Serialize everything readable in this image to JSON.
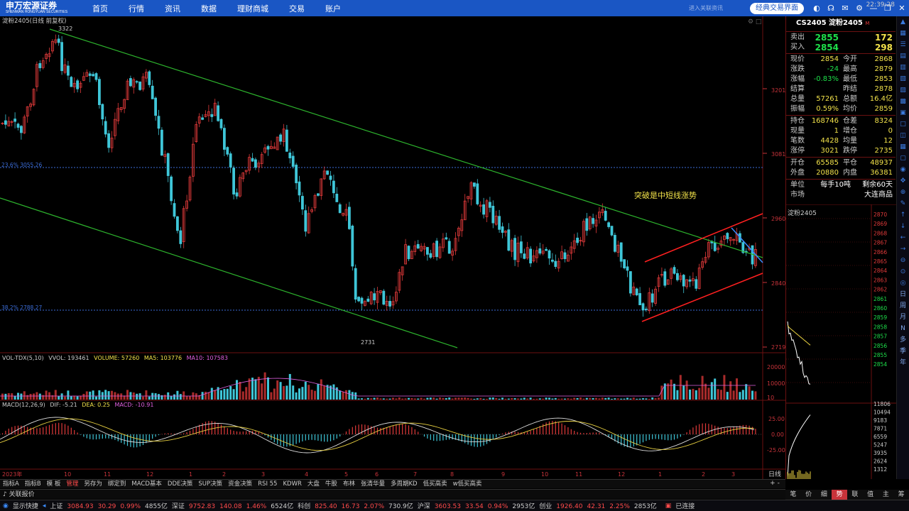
{
  "app": {
    "logo": "申万宏源证券",
    "logo_sub": "SHENWAN HONGYUAN SECURITIES",
    "nav": [
      "首页",
      "行情",
      "资讯",
      "数据",
      "理财商城",
      "交易",
      "账户"
    ],
    "hint": "进入关联资讯",
    "classic_button": "经典交易界面"
  },
  "chart": {
    "title": "淀粉2405(日线 前复权)",
    "high_label": "3322",
    "low_label": "2731",
    "fib1": "23.6% 3055.26",
    "fib2": "38.2% 2788.27",
    "annotation": "突破是中短线涨势",
    "price_axis": [
      "3201",
      "3081",
      "2960",
      "2840",
      "2719"
    ],
    "volume_header": {
      "indicator": "VOL-TDX(5,10)",
      "vvol": "VVOL: 193461",
      "volume": "VOLUME: 57260",
      "ma5": "MA5: 103776",
      "ma10": "MA10: 107583"
    },
    "volume_axis": [
      "20000",
      "10000",
      "10"
    ],
    "macd_header": {
      "indicator": "MACD(12,26,9)",
      "dif": "DIF: -5.21",
      "dea": "DEA: 0.25",
      "macd": "MACD: -10.91"
    },
    "macd_axis": [
      "25.00",
      "0.00",
      "-25.00"
    ],
    "date_axis": [
      "2023年",
      "10",
      "11",
      "12",
      "1",
      "2",
      "3",
      "4",
      "5",
      "6",
      "7",
      "8",
      "9",
      "10",
      "11",
      "12",
      "1",
      "2",
      "3"
    ],
    "period": "日线",
    "colors": {
      "up": "#e03a3a",
      "down": "#3fc6d8",
      "trend_green": "#2db32d",
      "channel_red": "#ff2020",
      "blue_line": "#3b8cff",
      "annotation": "#f2e24a"
    }
  },
  "quote": {
    "code": "CS2405",
    "name": "淀粉2405",
    "tag": "M",
    "ask": {
      "label": "卖出",
      "price": "2855",
      "vol": "172"
    },
    "bid": {
      "label": "买入",
      "price": "2854",
      "vol": "298"
    },
    "rows1": [
      {
        "l": "现价",
        "v": "2854",
        "l2": "今开",
        "v2": "2868"
      },
      {
        "l": "涨跌",
        "v": "-24",
        "l2": "最高",
        "v2": "2879"
      },
      {
        "l": "涨幅",
        "v": "-0.83%",
        "l2": "最低",
        "v2": "2853"
      },
      {
        "l": "结算",
        "v": "",
        "l2": "昨结",
        "v2": "2878"
      },
      {
        "l": "总量",
        "v": "57261",
        "l2": "总额",
        "v2": "16.4亿"
      },
      {
        "l": "振幅",
        "v": "0.59%",
        "l2": "均价",
        "v2": "2859"
      }
    ],
    "rows2": [
      {
        "l": "持仓",
        "v": "168746",
        "l2": "仓差",
        "v2": "8324"
      },
      {
        "l": "现量",
        "v": "1",
        "l2": "增仓",
        "v2": "0"
      },
      {
        "l": "笔数",
        "v": "4428",
        "l2": "均量",
        "v2": "12"
      },
      {
        "l": "涨停",
        "v": "3021",
        "l2": "跌停",
        "v2": "2735"
      }
    ],
    "rows3": [
      {
        "l": "开仓",
        "v": "65585",
        "l2": "平仓",
        "v2": "48937"
      },
      {
        "l": "外盘",
        "v": "20880",
        "l2": "内盘",
        "v2": "36381"
      }
    ],
    "unit": {
      "l": "单位",
      "v": "每手10吨",
      "v2": "剩余60天"
    },
    "market": {
      "l": "市场",
      "v2": "大连商品"
    },
    "mini_title": "淀粉2405",
    "mini_axis": [
      "2870",
      "2869",
      "2868",
      "2867",
      "2866",
      "2865",
      "2864",
      "2863",
      "2862",
      "2861",
      "2860",
      "2859",
      "2858",
      "2857",
      "2856",
      "2855",
      "2854"
    ],
    "mini_vol_axis": [
      "11806",
      "10494",
      "9183",
      "7871",
      "6559",
      "5247",
      "3935",
      "2624",
      "1312"
    ],
    "tabs": [
      "笔",
      "价",
      "细",
      "势",
      "联",
      "值",
      "主",
      "筹"
    ],
    "active_tab": "势"
  },
  "right_tools": [
    "日",
    "周",
    "月",
    "N",
    "多",
    "季",
    "年"
  ],
  "bottom_tabs": [
    "指标A",
    "指标B",
    "模 板",
    "管理",
    "另存为",
    "绑定到",
    "MACD基本",
    "DDE决策",
    "SUP决策",
    "资金决策",
    "RSI 55",
    "KDWR",
    "大盘",
    "牛股",
    "布林",
    "张清华量",
    "多周期KD",
    "低买高卖",
    "w低买高卖"
  ],
  "bottom_active": "管理",
  "alert_label": "关联报价",
  "status": {
    "quick": "显示快捷",
    "items": [
      {
        "name": "上证",
        "value": "3084.93",
        "chg": "30.29",
        "pct": "0.99%",
        "amt": "4855亿"
      },
      {
        "name": "深证",
        "value": "9752.83",
        "chg": "140.08",
        "pct": "1.46%",
        "amt": "6524亿"
      },
      {
        "name": "科创",
        "value": "825.40",
        "chg": "16.73",
        "pct": "2.07%",
        "amt": "730.9亿"
      },
      {
        "name": "沪深",
        "value": "3603.53",
        "chg": "33.54",
        "pct": "0.94%",
        "amt": "2953亿"
      },
      {
        "name": "创业",
        "value": "1926.40",
        "chg": "42.31",
        "pct": "2.25%",
        "amt": "2853亿"
      }
    ],
    "connected": "已连接",
    "time": "22:39:28"
  }
}
